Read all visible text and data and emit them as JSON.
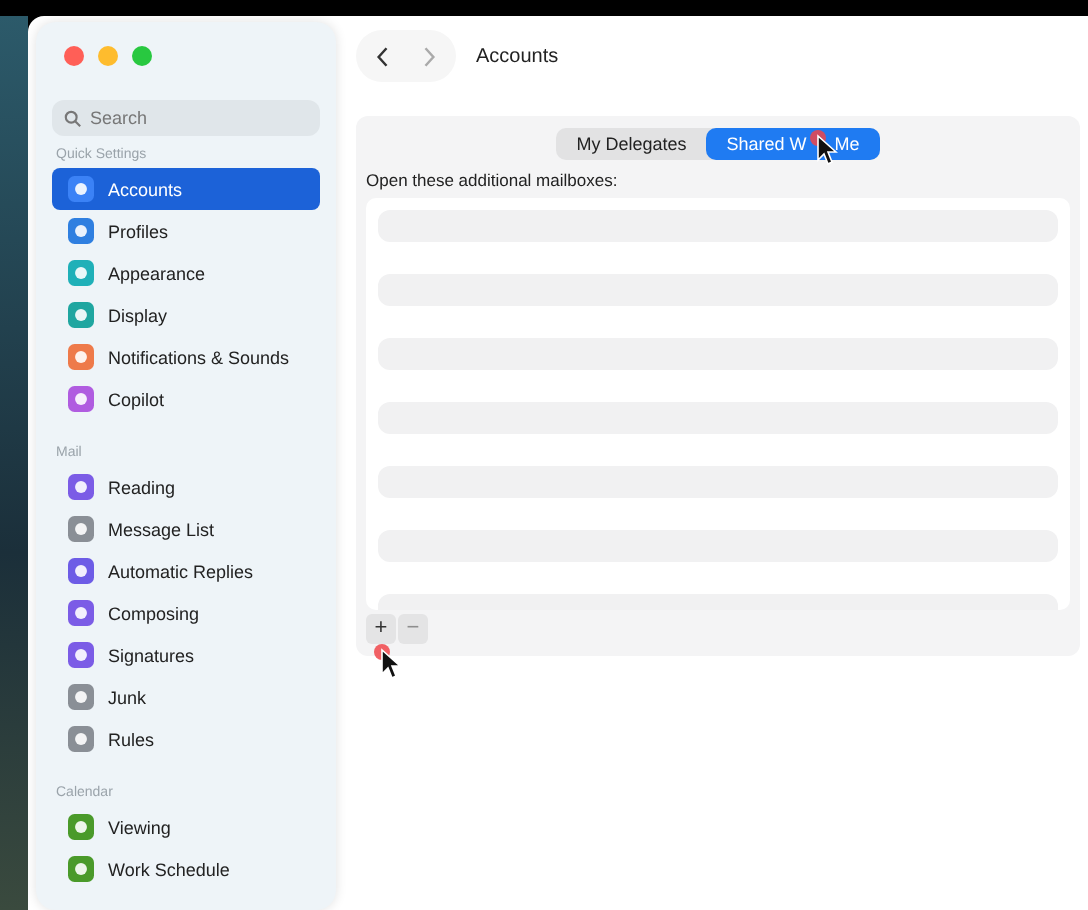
{
  "window": {
    "title": "Accounts"
  },
  "search": {
    "placeholder": "Search"
  },
  "sidebar": {
    "sections": [
      {
        "heading": "Quick Settings",
        "items": [
          {
            "label": "Accounts",
            "selected": true,
            "color": "#3b82f6"
          },
          {
            "label": "Profiles",
            "selected": false,
            "color": "#2f7fe0"
          },
          {
            "label": "Appearance",
            "selected": false,
            "color": "#1fb0b8"
          },
          {
            "label": "Display",
            "selected": false,
            "color": "#1fa6a0"
          },
          {
            "label": "Notifications & Sounds",
            "selected": false,
            "color": "#ee7a4a"
          },
          {
            "label": "Copilot",
            "selected": false,
            "color": "#b05ce0"
          }
        ]
      },
      {
        "heading": "Mail",
        "items": [
          {
            "label": "Reading",
            "selected": false,
            "color": "#7b5ce6"
          },
          {
            "label": "Message List",
            "selected": false,
            "color": "#8a8f96"
          },
          {
            "label": "Automatic Replies",
            "selected": false,
            "color": "#6d5ce6"
          },
          {
            "label": "Composing",
            "selected": false,
            "color": "#7b5ce6"
          },
          {
            "label": "Signatures",
            "selected": false,
            "color": "#7b5ce6"
          },
          {
            "label": "Junk",
            "selected": false,
            "color": "#8a8f96"
          },
          {
            "label": "Rules",
            "selected": false,
            "color": "#8a8f96"
          }
        ]
      },
      {
        "heading": "Calendar",
        "items": [
          {
            "label": "Viewing",
            "selected": false,
            "color": "#4a9a2a"
          },
          {
            "label": "Work Schedule",
            "selected": false,
            "color": "#4a9a2a"
          }
        ]
      }
    ]
  },
  "tabs": [
    {
      "label": "My Delegates",
      "selected": false
    },
    {
      "label_parts": [
        "Shared W",
        "Me"
      ],
      "selected": true
    }
  ],
  "list_label": "Open these additional mailboxes:",
  "list_buttons": [
    {
      "label": "+",
      "disabled": false
    },
    {
      "label": "−",
      "disabled": true
    }
  ]
}
